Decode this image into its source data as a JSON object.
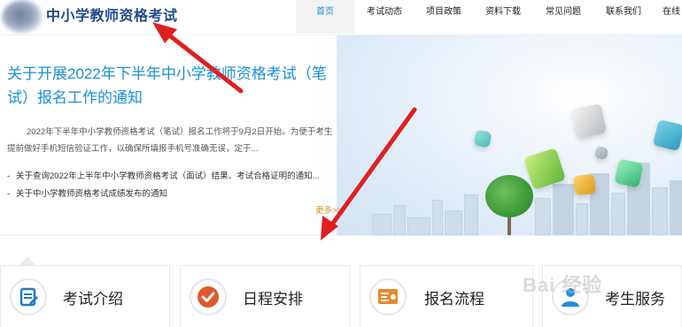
{
  "header": {
    "site_title": "中小学教师资格考试",
    "nav": [
      {
        "label": "首页",
        "active": true
      },
      {
        "label": "考试动态",
        "active": false
      },
      {
        "label": "项目政策",
        "active": false
      },
      {
        "label": "资料下载",
        "active": false
      },
      {
        "label": "常见问题",
        "active": false
      },
      {
        "label": "联系我们",
        "active": false
      },
      {
        "label": "在线",
        "active": false
      }
    ]
  },
  "hero": {
    "headline": "关于开展2022年下半年中小学教师资格考试（笔试）报名工作的通知",
    "summary": "2022年下半年中小学教师资格考试（笔试）报名工作将于9月2日开始。为便于考生提前做好手机短信验证工作，以确保所填报手机号准确无误，定于...",
    "links": [
      "关于查询2022年上半年中小学教师资格考试（面试）结果、考试合格证明的通知...",
      "关于中小学教师资格考试成绩发布的通知"
    ],
    "more_label": "更多>>"
  },
  "cards": [
    {
      "label": "考试介绍",
      "icon": "exam-intro-icon",
      "color": "#1f7ac8"
    },
    {
      "label": "日程安排",
      "icon": "schedule-check-icon",
      "color": "#e05a2a"
    },
    {
      "label": "报名流程",
      "icon": "registration-process-icon",
      "color": "#e8892a"
    },
    {
      "label": "考生服务",
      "icon": "candidate-service-icon",
      "color": "#1f8fd8"
    }
  ],
  "watermark": "Bai 经验",
  "colors": {
    "accent": "#1a8fd8",
    "title": "#1f4b8e",
    "more": "#e08a1e",
    "arrow": "#e02020"
  }
}
